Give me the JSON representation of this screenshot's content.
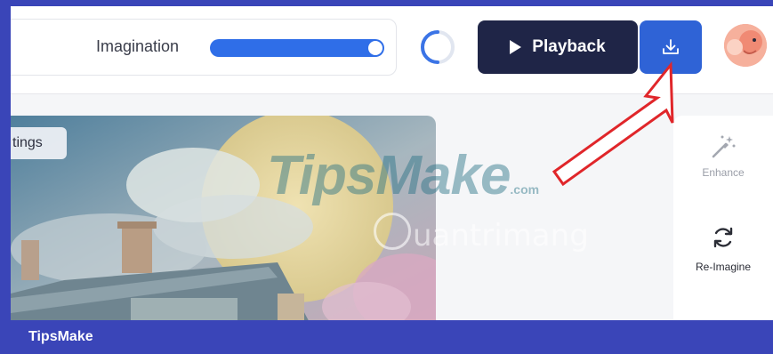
{
  "imagination": {
    "label": "Imagination",
    "level_fraction": 1.0
  },
  "toolbar": {
    "playback_label": "Playback"
  },
  "canvas": {
    "settings_chip_label": "tings"
  },
  "tools": {
    "enhance_label": "Enhance",
    "reimagine_label": "Re-Imagine"
  },
  "watermarks": {
    "primary_main": "TipsMake",
    "primary_suffix": ".com",
    "secondary": "uantrimang"
  },
  "footer": {
    "brand": "TipsMake"
  },
  "colors": {
    "accent_blue": "#2f63d6",
    "playback_bg": "#1f2547",
    "frame_border": "#3a45b8",
    "annotation_arrow": "#e0262a"
  },
  "icons": {
    "play": "play-icon",
    "download": "download-icon",
    "enhance": "magic-wand-icon",
    "reimagine": "refresh-icon",
    "spinner": "loading-spinner-icon"
  }
}
